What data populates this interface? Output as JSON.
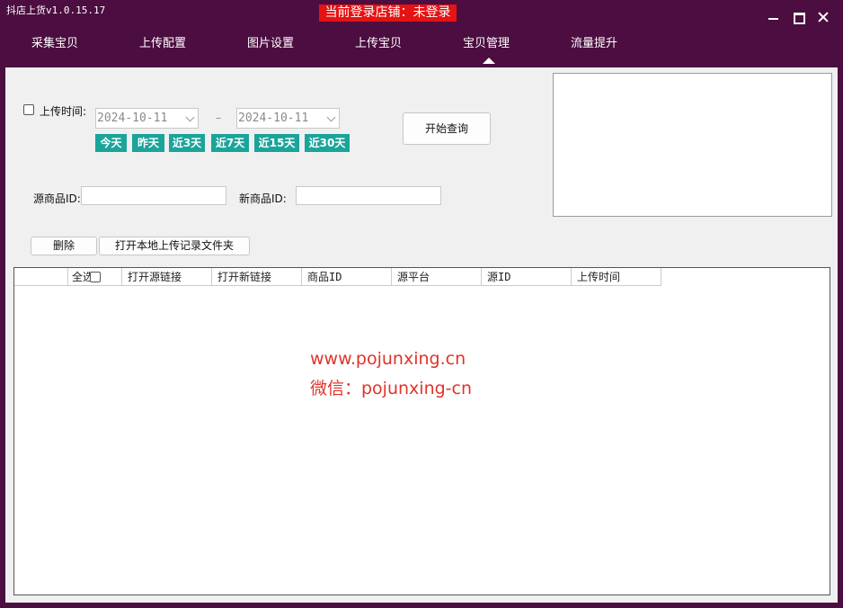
{
  "titlebar": {
    "app_title": "抖店上货v1.0.15.17",
    "login_status": "当前登录店铺：未登录"
  },
  "nav": {
    "tabs": [
      "采集宝贝",
      "上传配置",
      "图片设置",
      "上传宝贝",
      "宝贝管理",
      "流量提升"
    ],
    "active_tab": "宝贝管理"
  },
  "filters": {
    "upload_time_label": "上传时间:",
    "upload_time_checked": false,
    "start_date": "2024-10-11",
    "end_date": "2024-10-11",
    "date_separator": "–",
    "quick_ranges": [
      "今天",
      "昨天",
      "近3天",
      "近7天",
      "近15天",
      "近30天"
    ],
    "query_button": "开始查询",
    "source_id_label": "源商品ID:",
    "source_id_value": "",
    "new_id_label": "新商品ID:",
    "new_id_value": ""
  },
  "actions": {
    "delete_button": "删除",
    "open_folder_button": "打开本地上传记录文件夹"
  },
  "table": {
    "select_all_label": "全选",
    "columns": [
      "打开源链接",
      "打开新链接",
      "商品ID",
      "源平台",
      "源ID",
      "上传时间"
    ],
    "rows": []
  },
  "watermark": {
    "line1": "www.pojunxing.cn",
    "line2": "微信：pojunxing-cn"
  },
  "colors": {
    "frame": "#4c0d40",
    "login_badge": "#e51313",
    "quick_button": "#1aa49a",
    "watermark": "#e0332a"
  }
}
